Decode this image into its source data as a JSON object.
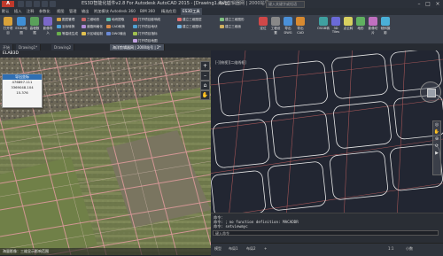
{
  "app": {
    "logo": "A",
    "title": "ES3D智能化插件v2.8 For Autodesk AutoCAD 2015 - [Drawing1.dwg]",
    "file_label": "海洋剪辑器网 | 2000站号 | 2.dwg",
    "search_placeholder": "键入关键字或短语"
  },
  "window_controls": [
    "–",
    "□",
    "×"
  ],
  "ribbon_tabs": [
    "默认",
    "插入",
    "注释",
    "参数化",
    "视图",
    "管理",
    "输出",
    "附加模块",
    "Autodesk 360",
    "BIM 360",
    "精选应用",
    "ES3D工具"
  ],
  "ribbon": {
    "left_buttons": [
      {
        "label": "打开项目"
      },
      {
        "label": "ES3D地图"
      },
      {
        "label": "高程数据"
      },
      {
        "label": "影像导入"
      }
    ],
    "small_buttons": [
      "图层管理",
      "坐标转换",
      "等高线生成",
      "三维地形",
      "道路网格化",
      "分区域绘制",
      "地块提取",
      "CAD转换",
      "DWG输出"
    ],
    "mid_buttons": [
      "打开项目影响线",
      "打开项目地块",
      "打开项目指标",
      "打开项目地图"
    ],
    "tool_buttons": [
      "建立三维图层",
      "建立三维图块",
      "建立三维图形",
      "建立三维面"
    ],
    "right_buttons": [
      {
        "label": "定位"
      },
      {
        "label": "工程设置"
      },
      {
        "label": "导出DWG"
      },
      {
        "label": "导出CAD"
      },
      {
        "label": "OSGB转"
      },
      {
        "label": "3D Tiles"
      },
      {
        "label": "点云转"
      },
      {
        "label": "地形"
      },
      {
        "label": "影像切片"
      },
      {
        "label": "倾斜摄影"
      }
    ],
    "panel_labels": [
      "项目",
      "地图",
      "工具",
      "三维转换",
      "ES3D工具"
    ]
  },
  "doc_tabs": [
    "开始",
    "Drawing1*",
    "Drawing2",
    "海洋剪辑器网 | 2000站号 | 2*"
  ],
  "left_viewport": {
    "label": "ELAB3D",
    "popup": {
      "title": "导出坐标",
      "lines": [
        "476897.111",
        "3369048.104",
        "15.376"
      ]
    },
    "nav_icons": [
      "+",
      "–",
      "⌂",
      "✋"
    ],
    "footer": "海量影像：三维显示影响范围"
  },
  "right_viewport": {
    "label": "[-][俯视][二维线框]"
  },
  "command": {
    "lines": [
      "命令：",
      "命令: ；no function definition: MACADDR",
      "命令: setviewmyc"
    ],
    "input_placeholder": "键入命令"
  },
  "status": {
    "items": [
      "模型",
      "布局1",
      "布局2",
      "+",
      "1:1",
      "小数"
    ]
  },
  "colors": {
    "ribbon": "#3b414c",
    "accent": "#2f6fb3",
    "road": "#c8a3a0",
    "parcel": "#e8e8e8"
  }
}
